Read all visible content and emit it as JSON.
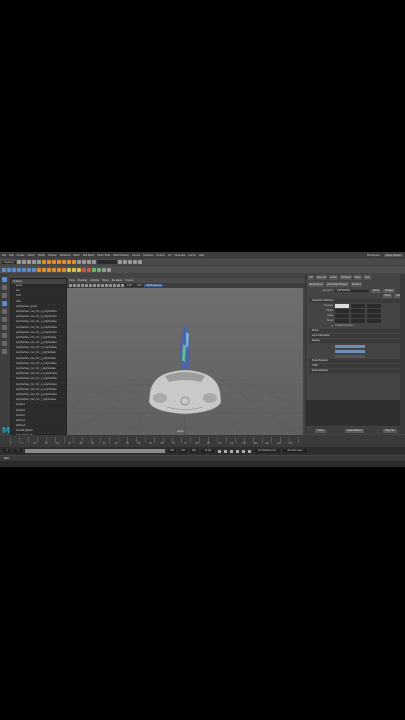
{
  "menubar": {
    "items": [
      "File",
      "Edit",
      "Create",
      "Select",
      "Modify",
      "Display",
      "Windows",
      "Mesh",
      "Edit Mesh",
      "Mesh Tools",
      "Mesh Display",
      "Curves",
      "Surfaces",
      "Deform",
      "UV",
      "Generate",
      "Cache",
      "Help"
    ],
    "workspace": "Workspace:",
    "workspace_value": "Maya Classic"
  },
  "shelf": {
    "menu_set": "Modeling",
    "tabs": [
      "Curves / Surfaces",
      "Polygons",
      "Sculpting",
      "Rigging",
      "Animation",
      "Rendering",
      "FX",
      "Custom"
    ]
  },
  "outliner": {
    "title": "Outliner",
    "rows": [
      "persp",
      "top",
      "front",
      "side",
      "polySurface_group",
      "polySurface_Car_01:_a_polySurface",
      "polySurface_Car_01:_b_polySurface",
      "polySurface_Car_01:_c_polySurface",
      "polySurface_Car_01:_d_polySurface",
      "polySurface_Car_01:_e_polySurface",
      "polySurface_Car_01:_f_polySurface",
      "polySurface_Car_01:_g_polySurface",
      "polySurface_Car_01:_h_polySurface",
      "polySurface_Car_01:_i_polySurface",
      "polySurface_Car_01:_j_polySurface",
      "polySurface_Car_01:_k_polySurface",
      "polySurface_Car_01:_l_polySurface",
      "polySurface_Car_01:_m_polySurface",
      "polySurface_Car_01:_n_polySurface",
      "polySurface_Car_01:_o_polySurface",
      "polySurface_Car_01:_p_polySurface",
      "polySurface_Car_01:_q_polySurface",
      "polySurface_Car_01:_r_polySurface",
      "pCube1",
      "pCube2",
      "pCube3",
      "pPlane1",
      "pPlane2",
      "defaultLightSet",
      "defaultObjectSet"
    ]
  },
  "viewport": {
    "menu": [
      "View",
      "Shading",
      "Lighting",
      "Show",
      "Renderer",
      "Panels"
    ],
    "field_a": "0.00",
    "field_b": "1.00",
    "color_space": "sRGB gamma",
    "camera_label": "persp"
  },
  "attribute_editor": {
    "tabs": [
      "List",
      "Selected",
      "Focus",
      "Attributes",
      "Show",
      "Help"
    ],
    "node_tabs": [
      "polySurface1",
      "polySurfaceShape1",
      "lambert1"
    ],
    "node_label": "transform:",
    "node_value": "polySurface1",
    "focus_btn": "Focus",
    "presets_btn": "Presets",
    "show_btn": "Show",
    "hide_btn": "Hide",
    "sections": [
      "Transform Attributes",
      "Pivots",
      "Limit Information",
      "Display",
      "Node Behavior",
      "UUID",
      "Extra Attributes"
    ],
    "fields": [
      {
        "label": "Translate",
        "v": [
          "0.000",
          "0.000",
          "0.000"
        ]
      },
      {
        "label": "Rotate",
        "v": [
          "0.000",
          "0.000",
          "0.000"
        ]
      },
      {
        "label": "Scale",
        "v": [
          "1.000",
          "1.000",
          "1.000"
        ]
      },
      {
        "label": "Shear",
        "v": [
          "0.000",
          "0.000",
          "0.000"
        ]
      }
    ],
    "inherits": "Inherits Transform",
    "bottom_buttons": [
      "Select",
      "Load Attributes",
      "Copy Tab"
    ]
  },
  "timeline": {
    "ticks": [
      "1",
      "5",
      "10",
      "15",
      "20",
      "25",
      "30",
      "35",
      "40",
      "45",
      "50",
      "55",
      "60",
      "65",
      "70",
      "75",
      "80",
      "85",
      "90",
      "95",
      "100",
      "105",
      "110",
      "115",
      "120"
    ]
  },
  "range": {
    "start": "1",
    "inner_start": "1",
    "inner_end": "120",
    "end": "120",
    "end2": "200",
    "fps": "24 fps",
    "char_set": "No Character Set",
    "anim_layer": "No Anim Layer"
  },
  "cmdline": {
    "label": "MEL"
  },
  "logo": {
    "text": "M"
  }
}
